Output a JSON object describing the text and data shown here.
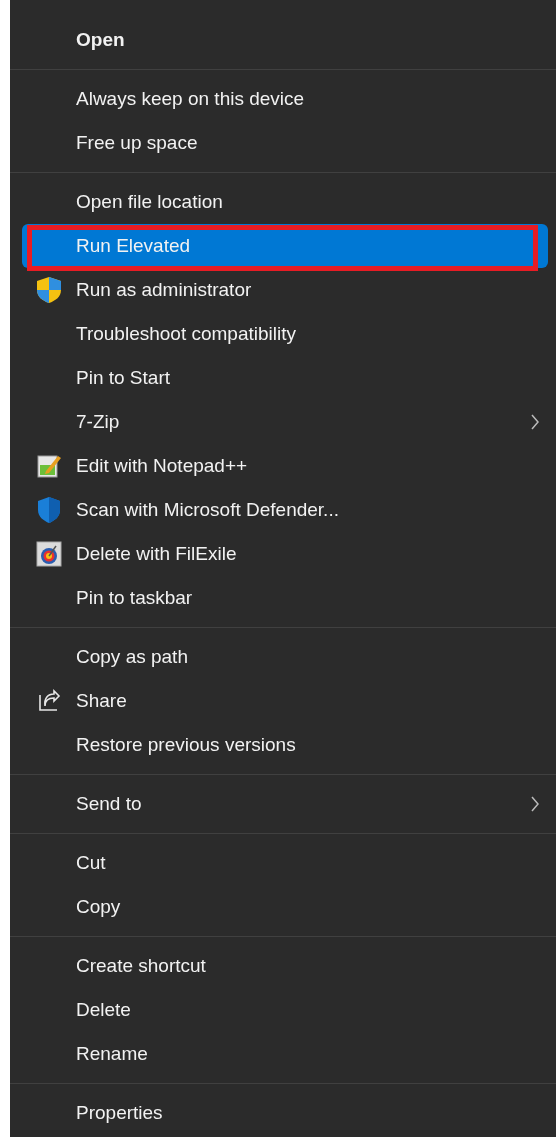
{
  "context_menu": {
    "groups": [
      {
        "items": [
          {
            "label": "Open",
            "kind": "default",
            "selected": false,
            "annotated": false
          }
        ]
      },
      {
        "items": [
          {
            "label": "Always keep on this device",
            "kind": "command",
            "selected": false,
            "annotated": false
          },
          {
            "label": "Free up space",
            "kind": "command",
            "selected": false,
            "annotated": false
          }
        ]
      },
      {
        "items": [
          {
            "label": "Open file location",
            "kind": "command",
            "selected": false,
            "annotated": false
          },
          {
            "label": "Run Elevated",
            "kind": "command",
            "selected": true,
            "annotated": true
          },
          {
            "label": "Run as administrator",
            "kind": "command",
            "selected": false,
            "annotated": false
          },
          {
            "label": "Troubleshoot compatibility",
            "kind": "command",
            "selected": false,
            "annotated": false
          },
          {
            "label": "Pin to Start",
            "kind": "command",
            "selected": false,
            "annotated": false
          },
          {
            "label": "7-Zip",
            "kind": "submenu",
            "selected": false,
            "annotated": false
          },
          {
            "label": "Edit with Notepad++",
            "kind": "command",
            "selected": false,
            "annotated": false
          },
          {
            "label": "Scan with Microsoft Defender...",
            "kind": "command",
            "selected": false,
            "annotated": false
          },
          {
            "label": "Delete with FilExile",
            "kind": "command",
            "selected": false,
            "annotated": false
          },
          {
            "label": "Pin to taskbar",
            "kind": "command",
            "selected": false,
            "annotated": false
          }
        ]
      },
      {
        "items": [
          {
            "label": "Copy as path",
            "kind": "command",
            "selected": false,
            "annotated": false
          },
          {
            "label": "Share",
            "kind": "command",
            "selected": false,
            "annotated": false
          },
          {
            "label": "Restore previous versions",
            "kind": "command",
            "selected": false,
            "annotated": false
          }
        ]
      },
      {
        "items": [
          {
            "label": "Send to",
            "kind": "submenu",
            "selected": false,
            "annotated": false
          }
        ]
      },
      {
        "items": [
          {
            "label": "Cut",
            "kind": "command",
            "selected": false,
            "annotated": false
          },
          {
            "label": "Copy",
            "kind": "command",
            "selected": false,
            "annotated": false
          }
        ]
      },
      {
        "items": [
          {
            "label": "Create shortcut",
            "kind": "command",
            "selected": false,
            "annotated": false
          },
          {
            "label": "Delete",
            "kind": "command",
            "selected": false,
            "annotated": false
          },
          {
            "label": "Rename",
            "kind": "command",
            "selected": false,
            "annotated": false
          }
        ]
      },
      {
        "items": [
          {
            "label": "Properties",
            "kind": "command",
            "selected": false,
            "annotated": false
          }
        ]
      }
    ]
  }
}
